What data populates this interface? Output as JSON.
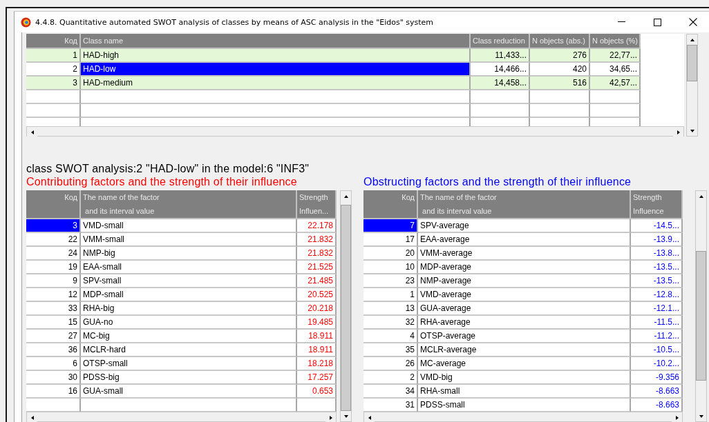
{
  "window": {
    "title": "4.4.8. Quantitative automated SWOT analysis of classes by means of ASC analysis in the \"Eidos\" system"
  },
  "classes_table": {
    "columns": [
      "Код",
      "Class name",
      "Class reduction",
      "N objects (abs.)",
      "N objects (%)"
    ],
    "rows": [
      {
        "code": "1",
        "name": "HAD-high",
        "reduction": "11,433...",
        "n_abs": "276",
        "n_pct": "22,77...",
        "selected": false
      },
      {
        "code": "2",
        "name": "HAD-low",
        "reduction": "14,466...",
        "n_abs": "420",
        "n_pct": "34,65...",
        "selected": true
      },
      {
        "code": "3",
        "name": "HAD-medium",
        "reduction": "14,458...",
        "n_abs": "516",
        "n_pct": "42,57...",
        "selected": false
      }
    ]
  },
  "analysis_title": "class SWOT analysis:2 \"HAD-low\" in the model:6 \"INF3\"",
  "contributing": {
    "title": "Contributing factors and the strength of their influence",
    "columns": [
      {
        "lines": [
          "Код"
        ]
      },
      {
        "lines": [
          "The name of the factor",
          "and its interval value"
        ]
      },
      {
        "lines": [
          "Strength",
          "Influen..."
        ]
      }
    ],
    "rows": [
      {
        "code": "3",
        "name": "VMD-small",
        "strength": "22.178",
        "selected": true
      },
      {
        "code": "22",
        "name": "VMM-small",
        "strength": "21.832",
        "selected": false
      },
      {
        "code": "24",
        "name": "NMP-big",
        "strength": "21.832",
        "selected": false
      },
      {
        "code": "19",
        "name": "EAA-small",
        "strength": "21.525",
        "selected": false
      },
      {
        "code": "9",
        "name": "SPV-small",
        "strength": "21.485",
        "selected": false
      },
      {
        "code": "12",
        "name": "MDP-small",
        "strength": "20.525",
        "selected": false
      },
      {
        "code": "33",
        "name": "RHA-big",
        "strength": "20.218",
        "selected": false
      },
      {
        "code": "15",
        "name": "GUA-no",
        "strength": "19.485",
        "selected": false
      },
      {
        "code": "27",
        "name": "MC-big",
        "strength": "18.911",
        "selected": false
      },
      {
        "code": "36",
        "name": "MCLR-hard",
        "strength": "18.911",
        "selected": false
      },
      {
        "code": "6",
        "name": "OTSP-small",
        "strength": "18.218",
        "selected": false
      },
      {
        "code": "30",
        "name": "PDSS-big",
        "strength": "17.257",
        "selected": false
      },
      {
        "code": "16",
        "name": "GUA-small",
        "strength": "0.653",
        "selected": false
      }
    ]
  },
  "obstructing": {
    "title": "Obstructing factors and the strength of their influence",
    "columns": [
      {
        "lines": [
          "Код"
        ]
      },
      {
        "lines": [
          "The name of the factor",
          "and its interval value"
        ]
      },
      {
        "lines": [
          "Strength",
          "Influence"
        ]
      }
    ],
    "rows": [
      {
        "code": "7",
        "name": "SPV-average",
        "strength": "-14.5...",
        "selected": true
      },
      {
        "code": "17",
        "name": "EAA-average",
        "strength": "-13.9...",
        "selected": false
      },
      {
        "code": "20",
        "name": "VMM-average",
        "strength": "-13.8...",
        "selected": false
      },
      {
        "code": "10",
        "name": "MDP-average",
        "strength": "-13.5...",
        "selected": false
      },
      {
        "code": "23",
        "name": "NMP-average",
        "strength": "-13.5...",
        "selected": false
      },
      {
        "code": "1",
        "name": "VMD-average",
        "strength": "-12.8...",
        "selected": false
      },
      {
        "code": "13",
        "name": "GUA-average",
        "strength": "-12.1...",
        "selected": false
      },
      {
        "code": "32",
        "name": "RHA-average",
        "strength": "-11.5...",
        "selected": false
      },
      {
        "code": "4",
        "name": "OTSP-average",
        "strength": "-11.2...",
        "selected": false
      },
      {
        "code": "35",
        "name": "MCLR-average",
        "strength": "-10.5...",
        "selected": false
      },
      {
        "code": "26",
        "name": "MC-average",
        "strength": "-10.2...",
        "selected": false
      },
      {
        "code": "2",
        "name": "VMD-big",
        "strength": "-9.356",
        "selected": false
      },
      {
        "code": "34",
        "name": "RHA-small",
        "strength": "-8.663",
        "selected": false
      },
      {
        "code": "31",
        "name": "PDSS-small",
        "strength": "-8.663",
        "selected": false
      }
    ]
  }
}
